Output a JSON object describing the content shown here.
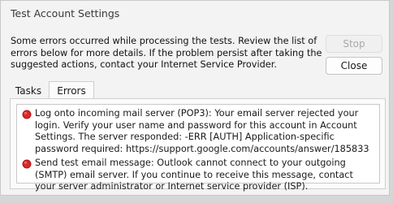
{
  "window": {
    "title": "Test Account Settings"
  },
  "message": "Some errors occurred while processing the tests. Review the list of errors below for more details. If the problem persist after taking the suggested actions, contact your Internet Service Provider.",
  "buttons": {
    "stop": "Stop",
    "close": "Close"
  },
  "tabs": [
    {
      "label": "Tasks"
    },
    {
      "label": "Errors"
    }
  ],
  "errors": [
    {
      "text": "Log onto incoming mail server (POP3): Your email server rejected your login. Verify your user name and password for this account in Account Settings.  The server responded: -ERR [AUTH] Application-specific password required: https://support.google.com/accounts/answer/185833",
      "icon": "error-icon"
    },
    {
      "text": "Send test email message: Outlook cannot connect to your outgoing (SMTP) email server. If you continue to receive this message, contact your server administrator or Internet service provider (ISP).",
      "icon": "error-icon"
    }
  ],
  "colors": {
    "dialog_bg": "#f3f3f3",
    "error_icon": "#b8161b"
  }
}
